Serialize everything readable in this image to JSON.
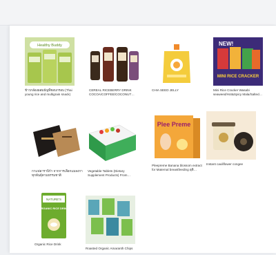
{
  "products": [
    {
      "name": "ข้าวกล้องผสมธัญพืชอบกรอบ (Thai young rice and multigrain snack)",
      "image_icon": "healthy-buddy-snack-bags-icon"
    },
    {
      "name": "CEREAL RICEBERRY DRINK COCOA/COFFEE/COCONUT…",
      "image_icon": "cereal-drink-cups-icon"
    },
    {
      "name": "CHIA SEED JELLY",
      "image_icon": "chia-jelly-pouch-icon"
    },
    {
      "name": "Mini Rice Cracker Wasabi seaweed/Hot&Spicy Mala/Salted…",
      "image_icon": "rice-cracker-bags-icon"
    },
    {
      "name": "กาแฟอาราบิก้า จากการเลือกแมลงกาทุกพันธุ์ตามธรรมชาติ",
      "image_icon": "coffee-box-icon"
    },
    {
      "name": "Vegetable Tablets (Dietary Supplement Products) From…",
      "image_icon": "vegetable-tablet-box-icon"
    },
    {
      "name": "Pleepreme Banana blossom extract for Maternal breastfeeding อุดิ…",
      "image_icon": "pleepreme-box-icon"
    },
    {
      "name": "Instant cauliflower congee",
      "image_icon": "congee-jar-icon"
    },
    {
      "name": "Organic Rice Drink",
      "image_icon": "organic-rice-drink-bag-icon"
    },
    {
      "name": "Roasted Organic Amaranth Chips",
      "image_icon": "amaranth-chips-packs-icon"
    }
  ],
  "labels": {
    "brand_1": "Healthy Buddy",
    "p4_new": "NEW!",
    "p4_title": "MINI RICE CRACKER",
    "p7_brand": "Plee Preme",
    "p9_brand": "NATURE'S",
    "p9_title": "ORGANIC RICE DRINK"
  },
  "colors": {
    "page_bg": "#ffffff",
    "frame_bg": "#eef0f3",
    "text": "#333333"
  }
}
